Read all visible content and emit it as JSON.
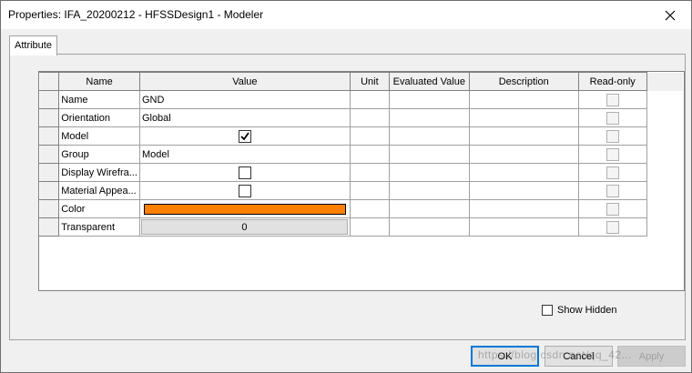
{
  "window": {
    "title": "Properties: IFA_20200212 - HFSSDesign1 - Modeler",
    "close_icon": "close-icon"
  },
  "tabs": [
    {
      "label": "Attribute"
    }
  ],
  "table": {
    "headers": [
      "Name",
      "Value",
      "Unit",
      "Evaluated Value",
      "Description",
      "Read-only"
    ],
    "rows": [
      {
        "name": "Name",
        "value": "GND",
        "kind": "text",
        "read_only": false
      },
      {
        "name": "Orientation",
        "value": "Global",
        "kind": "text",
        "read_only": false
      },
      {
        "name": "Model",
        "value": "",
        "kind": "checkbox",
        "checked": true,
        "read_only": false
      },
      {
        "name": "Group",
        "value": "Model",
        "kind": "text",
        "read_only": false
      },
      {
        "name": "Display Wirefra...",
        "value": "",
        "kind": "checkbox",
        "checked": false,
        "read_only": false
      },
      {
        "name": "Material Appea...",
        "value": "",
        "kind": "checkbox",
        "checked": false,
        "read_only": false
      },
      {
        "name": "Color",
        "value": "",
        "kind": "color",
        "color": "#ff8000",
        "read_only": false
      },
      {
        "name": "Transparent",
        "value": "0",
        "kind": "button",
        "read_only": false
      }
    ]
  },
  "options": {
    "show_hidden_label": "Show Hidden",
    "show_hidden_checked": false
  },
  "buttons": {
    "ok": "OK",
    "cancel": "Cancel",
    "apply": "Apply"
  },
  "watermark": "https://blog.csdn.net/qq_42... "
}
